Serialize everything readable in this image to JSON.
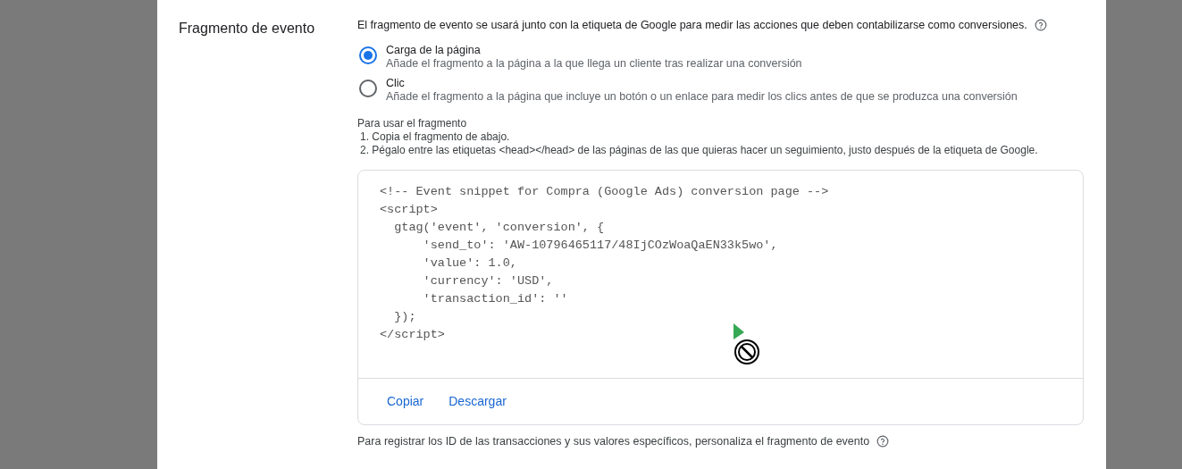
{
  "section": {
    "title": "Fragmento de evento",
    "intro": "El fragmento de evento se usará junto con la etiqueta de Google para medir las acciones que deben contabilizarse como conversiones."
  },
  "options": [
    {
      "label": "Carga de la página",
      "description": "Añade el fragmento a la página a la que llega un cliente tras realizar una conversión",
      "selected": true
    },
    {
      "label": "Clic",
      "description": "Añade el fragmento a la página que incluye un botón o un enlace para medir los clics antes de que se produzca una conversión",
      "selected": false
    }
  ],
  "instructions": {
    "heading": "Para usar el fragmento",
    "steps": [
      "1. Copia el fragmento de abajo.",
      "2. Pégalo entre las etiquetas <head></head> de las páginas de las que quieras hacer un seguimiento, justo después de la etiqueta de Google."
    ]
  },
  "code": [
    "<!-- Event snippet for Compra (Google Ads) conversion page -->",
    "<script>",
    "  gtag('event', 'conversion', {",
    "      'send_to': 'AW-10796465117/48IjCOzWoaQaEN33k5wo',",
    "      'value': 1.0,",
    "      'currency': 'USD',",
    "      'transaction_id': ''",
    "  });",
    "</script>"
  ],
  "actions": [
    "Copiar",
    "Descargar"
  ],
  "footer": "Para registrar los ID de las transacciones y sus valores específicos, personaliza el fragmento de evento"
}
